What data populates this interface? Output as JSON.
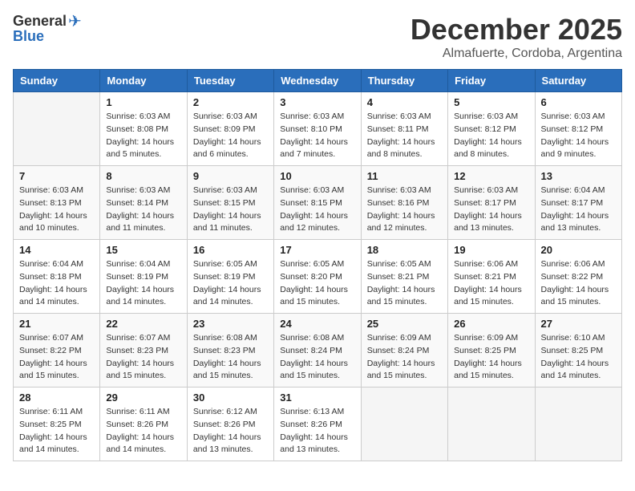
{
  "logo": {
    "general": "General",
    "blue": "Blue"
  },
  "title": "December 2025",
  "location": "Almafuerte, Cordoba, Argentina",
  "weekdays": [
    "Sunday",
    "Monday",
    "Tuesday",
    "Wednesday",
    "Thursday",
    "Friday",
    "Saturday"
  ],
  "weeks": [
    [
      {
        "day": "",
        "sunrise": "",
        "sunset": "",
        "daylight": ""
      },
      {
        "day": "1",
        "sunrise": "Sunrise: 6:03 AM",
        "sunset": "Sunset: 8:08 PM",
        "daylight": "Daylight: 14 hours and 5 minutes."
      },
      {
        "day": "2",
        "sunrise": "Sunrise: 6:03 AM",
        "sunset": "Sunset: 8:09 PM",
        "daylight": "Daylight: 14 hours and 6 minutes."
      },
      {
        "day": "3",
        "sunrise": "Sunrise: 6:03 AM",
        "sunset": "Sunset: 8:10 PM",
        "daylight": "Daylight: 14 hours and 7 minutes."
      },
      {
        "day": "4",
        "sunrise": "Sunrise: 6:03 AM",
        "sunset": "Sunset: 8:11 PM",
        "daylight": "Daylight: 14 hours and 8 minutes."
      },
      {
        "day": "5",
        "sunrise": "Sunrise: 6:03 AM",
        "sunset": "Sunset: 8:12 PM",
        "daylight": "Daylight: 14 hours and 8 minutes."
      },
      {
        "day": "6",
        "sunrise": "Sunrise: 6:03 AM",
        "sunset": "Sunset: 8:12 PM",
        "daylight": "Daylight: 14 hours and 9 minutes."
      }
    ],
    [
      {
        "day": "7",
        "sunrise": "Sunrise: 6:03 AM",
        "sunset": "Sunset: 8:13 PM",
        "daylight": "Daylight: 14 hours and 10 minutes."
      },
      {
        "day": "8",
        "sunrise": "Sunrise: 6:03 AM",
        "sunset": "Sunset: 8:14 PM",
        "daylight": "Daylight: 14 hours and 11 minutes."
      },
      {
        "day": "9",
        "sunrise": "Sunrise: 6:03 AM",
        "sunset": "Sunset: 8:15 PM",
        "daylight": "Daylight: 14 hours and 11 minutes."
      },
      {
        "day": "10",
        "sunrise": "Sunrise: 6:03 AM",
        "sunset": "Sunset: 8:15 PM",
        "daylight": "Daylight: 14 hours and 12 minutes."
      },
      {
        "day": "11",
        "sunrise": "Sunrise: 6:03 AM",
        "sunset": "Sunset: 8:16 PM",
        "daylight": "Daylight: 14 hours and 12 minutes."
      },
      {
        "day": "12",
        "sunrise": "Sunrise: 6:03 AM",
        "sunset": "Sunset: 8:17 PM",
        "daylight": "Daylight: 14 hours and 13 minutes."
      },
      {
        "day": "13",
        "sunrise": "Sunrise: 6:04 AM",
        "sunset": "Sunset: 8:17 PM",
        "daylight": "Daylight: 14 hours and 13 minutes."
      }
    ],
    [
      {
        "day": "14",
        "sunrise": "Sunrise: 6:04 AM",
        "sunset": "Sunset: 8:18 PM",
        "daylight": "Daylight: 14 hours and 14 minutes."
      },
      {
        "day": "15",
        "sunrise": "Sunrise: 6:04 AM",
        "sunset": "Sunset: 8:19 PM",
        "daylight": "Daylight: 14 hours and 14 minutes."
      },
      {
        "day": "16",
        "sunrise": "Sunrise: 6:05 AM",
        "sunset": "Sunset: 8:19 PM",
        "daylight": "Daylight: 14 hours and 14 minutes."
      },
      {
        "day": "17",
        "sunrise": "Sunrise: 6:05 AM",
        "sunset": "Sunset: 8:20 PM",
        "daylight": "Daylight: 14 hours and 15 minutes."
      },
      {
        "day": "18",
        "sunrise": "Sunrise: 6:05 AM",
        "sunset": "Sunset: 8:21 PM",
        "daylight": "Daylight: 14 hours and 15 minutes."
      },
      {
        "day": "19",
        "sunrise": "Sunrise: 6:06 AM",
        "sunset": "Sunset: 8:21 PM",
        "daylight": "Daylight: 14 hours and 15 minutes."
      },
      {
        "day": "20",
        "sunrise": "Sunrise: 6:06 AM",
        "sunset": "Sunset: 8:22 PM",
        "daylight": "Daylight: 14 hours and 15 minutes."
      }
    ],
    [
      {
        "day": "21",
        "sunrise": "Sunrise: 6:07 AM",
        "sunset": "Sunset: 8:22 PM",
        "daylight": "Daylight: 14 hours and 15 minutes."
      },
      {
        "day": "22",
        "sunrise": "Sunrise: 6:07 AM",
        "sunset": "Sunset: 8:23 PM",
        "daylight": "Daylight: 14 hours and 15 minutes."
      },
      {
        "day": "23",
        "sunrise": "Sunrise: 6:08 AM",
        "sunset": "Sunset: 8:23 PM",
        "daylight": "Daylight: 14 hours and 15 minutes."
      },
      {
        "day": "24",
        "sunrise": "Sunrise: 6:08 AM",
        "sunset": "Sunset: 8:24 PM",
        "daylight": "Daylight: 14 hours and 15 minutes."
      },
      {
        "day": "25",
        "sunrise": "Sunrise: 6:09 AM",
        "sunset": "Sunset: 8:24 PM",
        "daylight": "Daylight: 14 hours and 15 minutes."
      },
      {
        "day": "26",
        "sunrise": "Sunrise: 6:09 AM",
        "sunset": "Sunset: 8:25 PM",
        "daylight": "Daylight: 14 hours and 15 minutes."
      },
      {
        "day": "27",
        "sunrise": "Sunrise: 6:10 AM",
        "sunset": "Sunset: 8:25 PM",
        "daylight": "Daylight: 14 hours and 14 minutes."
      }
    ],
    [
      {
        "day": "28",
        "sunrise": "Sunrise: 6:11 AM",
        "sunset": "Sunset: 8:25 PM",
        "daylight": "Daylight: 14 hours and 14 minutes."
      },
      {
        "day": "29",
        "sunrise": "Sunrise: 6:11 AM",
        "sunset": "Sunset: 8:26 PM",
        "daylight": "Daylight: 14 hours and 14 minutes."
      },
      {
        "day": "30",
        "sunrise": "Sunrise: 6:12 AM",
        "sunset": "Sunset: 8:26 PM",
        "daylight": "Daylight: 14 hours and 13 minutes."
      },
      {
        "day": "31",
        "sunrise": "Sunrise: 6:13 AM",
        "sunset": "Sunset: 8:26 PM",
        "daylight": "Daylight: 14 hours and 13 minutes."
      },
      {
        "day": "",
        "sunrise": "",
        "sunset": "",
        "daylight": ""
      },
      {
        "day": "",
        "sunrise": "",
        "sunset": "",
        "daylight": ""
      },
      {
        "day": "",
        "sunrise": "",
        "sunset": "",
        "daylight": ""
      }
    ]
  ]
}
